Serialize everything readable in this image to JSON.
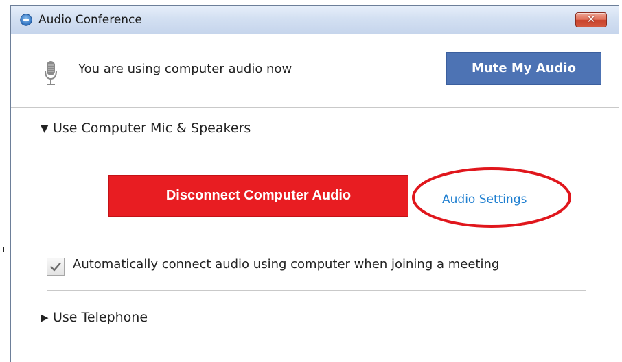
{
  "window": {
    "title": "Audio Conference",
    "close_label": "✕"
  },
  "status": {
    "text": "You are using computer audio now",
    "mute_button": {
      "prefix": "Mute My ",
      "underlined": "A",
      "suffix": "udio"
    }
  },
  "computer_section": {
    "caret": "▼",
    "header": "Use Computer Mic & Speakers",
    "disconnect_label": "Disconnect Computer Audio",
    "settings_link": "Audio Settings",
    "auto_connect_label": "Automatically connect audio using computer when joining a meeting",
    "auto_connect_checked": true
  },
  "telephone_section": {
    "caret": "▶",
    "header": "Use Telephone"
  },
  "icons": {
    "title": "audio-conference-icon",
    "close": "close-icon",
    "mic": "microphone-icon",
    "check": "checkmark-icon"
  },
  "colors": {
    "mute_button": "#4d73b4",
    "disconnect_button": "#e81d22",
    "link": "#1f7fd0",
    "highlight": "#e0161c",
    "titlebar": "#d3e0f2"
  }
}
